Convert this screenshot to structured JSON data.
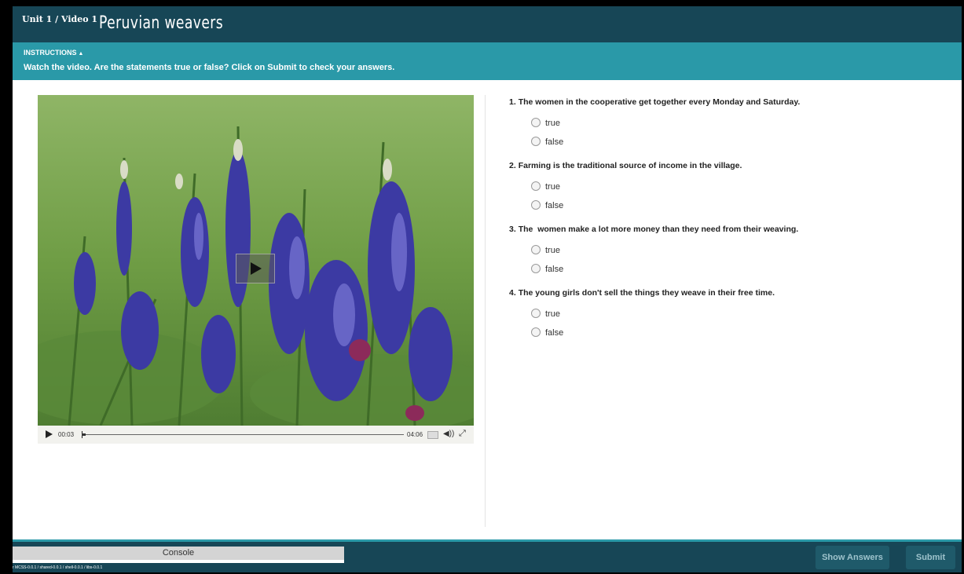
{
  "header": {
    "breadcrumb": "Unit 1 / Video 1",
    "title": "Peruvian weavers"
  },
  "instructions": {
    "heading": "INSTRUCTIONS",
    "toggle_icon": "caret-up-icon",
    "text": "Watch the video. Are the statements true or false? Click on Submit to check your answers."
  },
  "video": {
    "current_time": "00:03",
    "duration": "04:06",
    "progress_fraction": 0.012,
    "icons": {
      "play": "play-icon",
      "captions": "captions-icon",
      "volume": "volume-icon",
      "fullscreen": "fullscreen-icon"
    }
  },
  "questions": [
    {
      "number": "1.",
      "text": "The women in the cooperative get together every Monday and Saturday.",
      "options": [
        "true",
        "false"
      ]
    },
    {
      "number": "2.",
      "text": "Farming is the traditional source of income in the village.",
      "options": [
        "true",
        "false"
      ]
    },
    {
      "number": "3.",
      "text": "The  women make a lot more money than they need from their weaving.",
      "options": [
        "true",
        "false"
      ]
    },
    {
      "number": "4.",
      "text": "The young girls don't sell the things they weave in their free time.",
      "options": [
        "true",
        "false"
      ]
    }
  ],
  "footer": {
    "console_label": "Console",
    "version": "r MCSS-0.0.1 / shared-0.0.1 / shell-0.0.1 / libs-0.0.1",
    "show_answers_label": "Show Answers",
    "submit_label": "Submit"
  },
  "colors": {
    "header_bg": "#174656",
    "instructions_bg": "#2a99a8",
    "button_bg": "#1f5a6a"
  }
}
